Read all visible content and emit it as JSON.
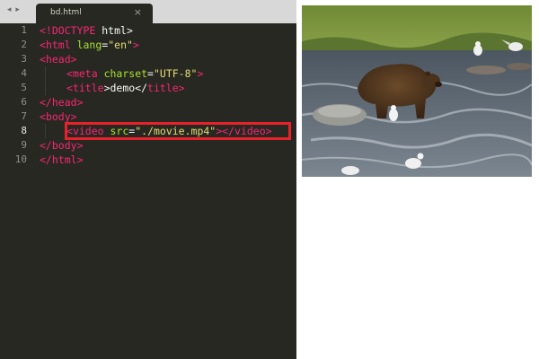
{
  "editor": {
    "nav_arrows": "◂ ▸",
    "tab": {
      "name": "bd.html",
      "close": "×"
    },
    "active_line": 8,
    "lines": [
      {
        "num": "1",
        "parts": [
          "<!",
          "DOCTYPE",
          " html>"
        ]
      },
      {
        "num": "2",
        "parts": [
          "<",
          "html",
          " ",
          "lang",
          "=",
          "\"en\"",
          ">"
        ]
      },
      {
        "num": "3",
        "parts": [
          "<",
          "head",
          ">"
        ]
      },
      {
        "num": "4",
        "parts": [
          "<",
          "meta",
          " ",
          "charset",
          "=",
          "\"UTF-8\"",
          ">"
        ]
      },
      {
        "num": "5",
        "parts": [
          "<",
          "title",
          ">demo</",
          "title",
          ">"
        ]
      },
      {
        "num": "6",
        "parts": [
          "</",
          "head",
          ">"
        ]
      },
      {
        "num": "7",
        "parts": [
          "<",
          "body",
          ">"
        ]
      },
      {
        "num": "8",
        "parts": [
          "<",
          "video",
          " ",
          "src",
          "=",
          "\"./movie.mp4\"",
          "></",
          "video",
          ">"
        ]
      },
      {
        "num": "9",
        "parts": [
          "</",
          "body",
          ">"
        ]
      },
      {
        "num": "10",
        "parts": [
          "</",
          "html",
          ">"
        ]
      }
    ]
  },
  "colors": {
    "editor_bg": "#272822",
    "tag": "#f92672",
    "attribute": "#a6e22e",
    "string": "#e6db74",
    "highlight_box": "#e8222b"
  },
  "video_preview": {
    "icon": "video-frame-bear-in-river"
  }
}
